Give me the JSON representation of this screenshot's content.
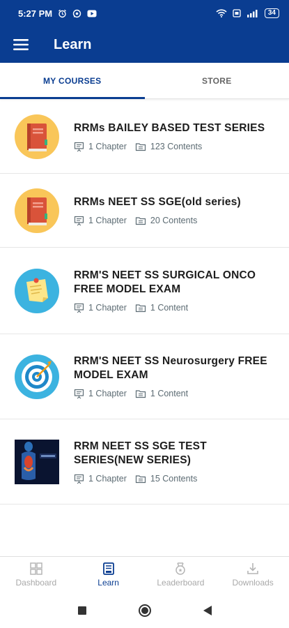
{
  "status_bar": {
    "time": "5:27 PM",
    "battery": "34"
  },
  "app_bar": {
    "title": "Learn"
  },
  "tabs": [
    {
      "label": "MY COURSES",
      "active": true
    },
    {
      "label": "STORE",
      "active": false
    }
  ],
  "courses": [
    {
      "title": "RRMs BAILEY BASED TEST SERIES",
      "chapters": "1 Chapter",
      "contents": "123 Contents",
      "icon": "book-icon"
    },
    {
      "title": "RRMs NEET SS SGE(old series)",
      "chapters": "1 Chapter",
      "contents": "20 Contents",
      "icon": "book-icon"
    },
    {
      "title": "RRM'S NEET SS SURGICAL ONCO FREE MODEL EXAM",
      "chapters": "1 Chapter",
      "contents": "1 Content",
      "icon": "sticky-note-icon"
    },
    {
      "title": "RRM'S NEET SS Neurosurgery FREE MODEL EXAM",
      "chapters": "1 Chapter",
      "contents": "1 Content",
      "icon": "target-icon"
    },
    {
      "title": "RRM NEET SS SGE TEST SERIES(NEW SERIES)",
      "chapters": "1 Chapter",
      "contents": "15 Contents",
      "icon": "anatomy-image"
    }
  ],
  "bottom_nav": [
    {
      "label": "Dashboard",
      "icon": "dashboard-icon",
      "active": false
    },
    {
      "label": "Learn",
      "icon": "learn-icon",
      "active": true
    },
    {
      "label": "Leaderboard",
      "icon": "leaderboard-icon",
      "active": false
    },
    {
      "label": "Downloads",
      "icon": "downloads-icon",
      "active": false
    }
  ],
  "colors": {
    "primary": "#0a3d91",
    "thumb_yellow": "#f9c659",
    "thumb_blue": "#3cb3e0",
    "book_red": "#d9533a"
  }
}
